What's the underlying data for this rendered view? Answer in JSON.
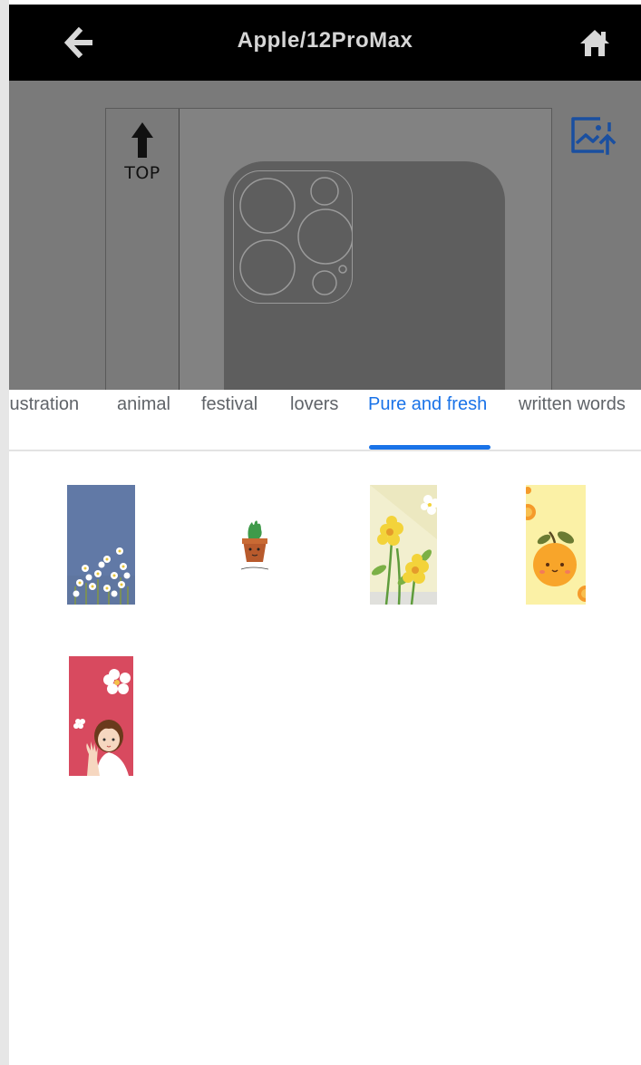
{
  "header": {
    "title": "Apple/12ProMax",
    "back_icon": "arrow-left-icon",
    "home_icon": "home-icon"
  },
  "preview": {
    "top_label": "TOP",
    "upload_icon": "image-upload-icon"
  },
  "tabs": [
    {
      "label": "Illustration"
    },
    {
      "label": "animal"
    },
    {
      "label": "festival"
    },
    {
      "label": "lovers"
    },
    {
      "label": "Pure and fresh",
      "active": true
    },
    {
      "label": "written words"
    }
  ],
  "grid_items": [
    {
      "name": "daisies-blue-background"
    },
    {
      "name": "cactus-pot"
    },
    {
      "name": "yellow-flowers"
    },
    {
      "name": "orange-fruit"
    },
    {
      "name": "girl-with-flowers-pink"
    }
  ],
  "colors": {
    "header_bg": "#000000",
    "active_tab": "#1a73e8",
    "upload_icon": "#1a4fa0",
    "preview_bg": "#7a7a7a"
  }
}
